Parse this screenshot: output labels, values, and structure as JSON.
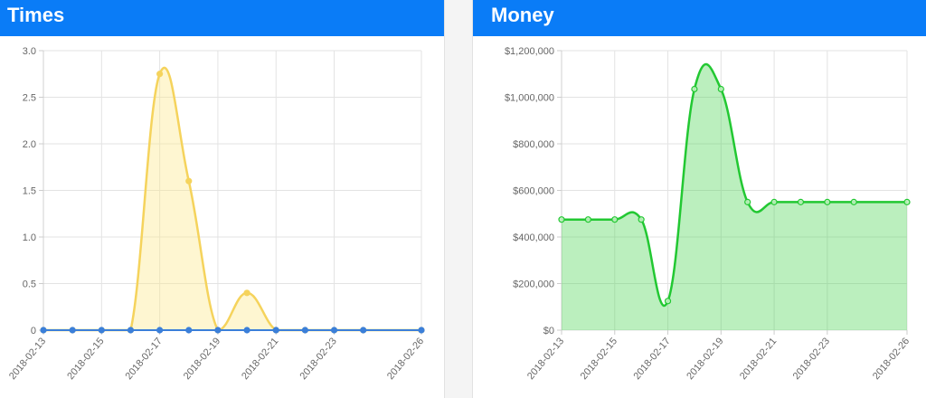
{
  "colors": {
    "header_bg": "#0a7cf7",
    "times_series1": "#f5d35c",
    "times_series1_fill": "rgba(252,232,140,0.4)",
    "times_series2": "#3b7fd9",
    "money_line": "#22c832",
    "money_fill": "rgba(60,210,70,0.35)"
  },
  "panels": {
    "times": {
      "title": "Times"
    },
    "money": {
      "title": "Money"
    }
  },
  "chart_data": [
    {
      "type": "area",
      "title": "Times",
      "x": [
        "2018-02-13",
        "2018-02-14",
        "2018-02-15",
        "2018-02-16",
        "2018-02-17",
        "2018-02-18",
        "2018-02-19",
        "2018-02-20",
        "2018-02-21",
        "2018-02-22",
        "2018-02-23",
        "2018-02-24",
        "2018-02-26"
      ],
      "x_tick_labels": [
        "2018-02-13",
        "2018-02-15",
        "2018-02-17",
        "2018-02-19",
        "2018-02-21",
        "2018-02-23",
        "2018-02-26"
      ],
      "y_tick_labels": [
        "0",
        "0.5",
        "1.0",
        "1.5",
        "2.0",
        "2.5",
        "3.0"
      ],
      "ylim": [
        0,
        3
      ],
      "grid": true,
      "series": [
        {
          "values": [
            0,
            0,
            0,
            0,
            2.75,
            1.6,
            0,
            0.4,
            0,
            0,
            0,
            0,
            0
          ]
        },
        {
          "values": [
            0,
            0,
            0,
            0,
            0,
            0,
            0,
            0,
            0,
            0,
            0,
            0,
            0
          ]
        }
      ]
    },
    {
      "type": "area",
      "title": "Money",
      "x": [
        "2018-02-13",
        "2018-02-14",
        "2018-02-15",
        "2018-02-16",
        "2018-02-17",
        "2018-02-18",
        "2018-02-19",
        "2018-02-20",
        "2018-02-21",
        "2018-02-22",
        "2018-02-23",
        "2018-02-24",
        "2018-02-26"
      ],
      "x_tick_labels": [
        "2018-02-13",
        "2018-02-15",
        "2018-02-17",
        "2018-02-19",
        "2018-02-21",
        "2018-02-23",
        "2018-02-26"
      ],
      "y_tick_labels": [
        "$0",
        "$200,000",
        "$400,000",
        "$600,000",
        "$800,000",
        "$1,000,000",
        "$1,200,000"
      ],
      "ylim": [
        0,
        1200000
      ],
      "grid": true,
      "series": [
        {
          "values": [
            475000,
            475000,
            475000,
            475000,
            125000,
            1035000,
            1035000,
            550000,
            550000,
            550000,
            550000,
            550000,
            550000
          ]
        }
      ]
    }
  ]
}
